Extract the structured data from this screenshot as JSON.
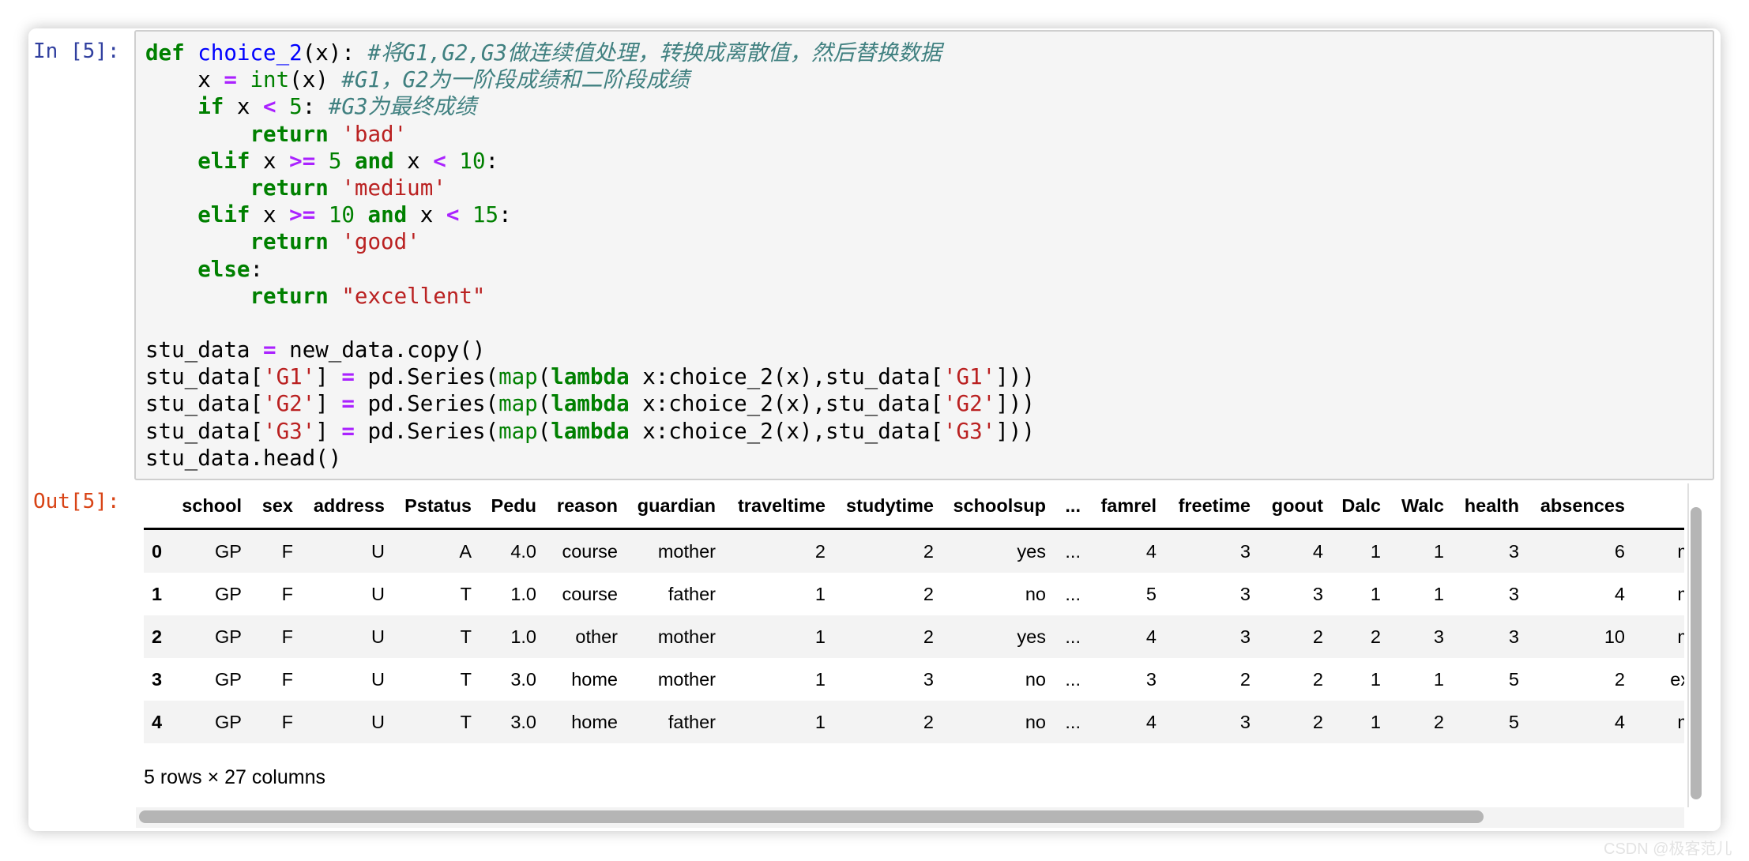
{
  "input_prompt": "In [5]:",
  "output_prompt": "Out[5]:",
  "code_lines": [
    [
      [
        "kw",
        "def"
      ],
      [
        "t",
        " "
      ],
      [
        "fn",
        "choice_2"
      ],
      [
        "t",
        "(x): "
      ],
      [
        "cm",
        "#将G1,G2,G3做连续值处理，转换成离散值，然后替换数据"
      ]
    ],
    [
      [
        "t",
        "    x "
      ],
      [
        "op",
        "="
      ],
      [
        "t",
        " "
      ],
      [
        "bi",
        "int"
      ],
      [
        "t",
        "(x) "
      ],
      [
        "cm",
        "#G1，G2为一阶段成绩和二阶段成绩"
      ]
    ],
    [
      [
        "t",
        "    "
      ],
      [
        "kw",
        "if"
      ],
      [
        "t",
        " x "
      ],
      [
        "op",
        "<"
      ],
      [
        "t",
        " "
      ],
      [
        "nu",
        "5"
      ],
      [
        "t",
        ": "
      ],
      [
        "cm",
        "#G3为最终成绩"
      ]
    ],
    [
      [
        "t",
        "        "
      ],
      [
        "kw",
        "return"
      ],
      [
        "t",
        " "
      ],
      [
        "st",
        "'bad'"
      ]
    ],
    [
      [
        "t",
        "    "
      ],
      [
        "kw",
        "elif"
      ],
      [
        "t",
        " x "
      ],
      [
        "op",
        ">="
      ],
      [
        "t",
        " "
      ],
      [
        "nu",
        "5"
      ],
      [
        "t",
        " "
      ],
      [
        "kw",
        "and"
      ],
      [
        "t",
        " x "
      ],
      [
        "op",
        "<"
      ],
      [
        "t",
        " "
      ],
      [
        "nu",
        "10"
      ],
      [
        "t",
        ":"
      ]
    ],
    [
      [
        "t",
        "        "
      ],
      [
        "kw",
        "return"
      ],
      [
        "t",
        " "
      ],
      [
        "st",
        "'medium'"
      ]
    ],
    [
      [
        "t",
        "    "
      ],
      [
        "kw",
        "elif"
      ],
      [
        "t",
        " x "
      ],
      [
        "op",
        ">="
      ],
      [
        "t",
        " "
      ],
      [
        "nu",
        "10"
      ],
      [
        "t",
        " "
      ],
      [
        "kw",
        "and"
      ],
      [
        "t",
        " x "
      ],
      [
        "op",
        "<"
      ],
      [
        "t",
        " "
      ],
      [
        "nu",
        "15"
      ],
      [
        "t",
        ":"
      ]
    ],
    [
      [
        "t",
        "        "
      ],
      [
        "kw",
        "return"
      ],
      [
        "t",
        " "
      ],
      [
        "st",
        "'good'"
      ]
    ],
    [
      [
        "t",
        "    "
      ],
      [
        "kw",
        "else"
      ],
      [
        "t",
        ":"
      ]
    ],
    [
      [
        "t",
        "        "
      ],
      [
        "kw",
        "return"
      ],
      [
        "t",
        " "
      ],
      [
        "st",
        "\"excellent\""
      ]
    ],
    [
      [
        "t",
        ""
      ]
    ],
    [
      [
        "t",
        "stu_data "
      ],
      [
        "op",
        "="
      ],
      [
        "t",
        " new_data.copy()"
      ]
    ],
    [
      [
        "t",
        "stu_data["
      ],
      [
        "st",
        "'G1'"
      ],
      [
        "t",
        "] "
      ],
      [
        "op",
        "="
      ],
      [
        "t",
        " pd.Series("
      ],
      [
        "bi",
        "map"
      ],
      [
        "t",
        "("
      ],
      [
        "kw",
        "lambda"
      ],
      [
        "t",
        " x:choice_2(x),stu_data["
      ],
      [
        "st",
        "'G1'"
      ],
      [
        "t",
        "]))"
      ]
    ],
    [
      [
        "t",
        "stu_data["
      ],
      [
        "st",
        "'G2'"
      ],
      [
        "t",
        "] "
      ],
      [
        "op",
        "="
      ],
      [
        "t",
        " pd.Series("
      ],
      [
        "bi",
        "map"
      ],
      [
        "t",
        "("
      ],
      [
        "kw",
        "lambda"
      ],
      [
        "t",
        " x:choice_2(x),stu_data["
      ],
      [
        "st",
        "'G2'"
      ],
      [
        "t",
        "]))"
      ]
    ],
    [
      [
        "t",
        "stu_data["
      ],
      [
        "st",
        "'G3'"
      ],
      [
        "t",
        "] "
      ],
      [
        "op",
        "="
      ],
      [
        "t",
        " pd.Series("
      ],
      [
        "bi",
        "map"
      ],
      [
        "t",
        "("
      ],
      [
        "kw",
        "lambda"
      ],
      [
        "t",
        " x:choice_2(x),stu_data["
      ],
      [
        "st",
        "'G3'"
      ],
      [
        "t",
        "]))"
      ]
    ],
    [
      [
        "t",
        "stu_data.head()"
      ]
    ]
  ],
  "table": {
    "columns": [
      "",
      "school",
      "sex",
      "address",
      "Pstatus",
      "Pedu",
      "reason",
      "guardian",
      "traveltime",
      "studytime",
      "schoolsup",
      "...",
      "famrel",
      "freetime",
      "goout",
      "Dalc",
      "Walc",
      "health",
      "absences",
      ""
    ],
    "rows": [
      [
        "0",
        "GP",
        "F",
        "U",
        "A",
        "4.0",
        "course",
        "mother",
        "2",
        "2",
        "yes",
        "...",
        "4",
        "3",
        "4",
        "1",
        "1",
        "3",
        "6",
        "medium"
      ],
      [
        "1",
        "GP",
        "F",
        "U",
        "T",
        "1.0",
        "course",
        "father",
        "1",
        "2",
        "no",
        "...",
        "5",
        "3",
        "3",
        "1",
        "1",
        "3",
        "4",
        "medium"
      ],
      [
        "2",
        "GP",
        "F",
        "U",
        "T",
        "1.0",
        "other",
        "mother",
        "1",
        "2",
        "yes",
        "...",
        "4",
        "3",
        "2",
        "2",
        "3",
        "3",
        "10",
        "medium"
      ],
      [
        "3",
        "GP",
        "F",
        "U",
        "T",
        "3.0",
        "home",
        "mother",
        "1",
        "3",
        "no",
        "...",
        "3",
        "2",
        "2",
        "1",
        "1",
        "5",
        "2",
        "excellent"
      ],
      [
        "4",
        "GP",
        "F",
        "U",
        "T",
        "3.0",
        "home",
        "father",
        "1",
        "2",
        "no",
        "...",
        "4",
        "3",
        "2",
        "1",
        "2",
        "5",
        "4",
        "medium"
      ]
    ],
    "summary": "5 rows × 27 columns"
  },
  "watermark": "CSDN @极客范儿",
  "colors": {
    "input_prompt": "#303F9F",
    "output_prompt": "#D84315",
    "keyword": "#008000",
    "comment": "#408080",
    "string": "#BA2121",
    "operator": "#AA22FF",
    "function": "#0000FF"
  }
}
